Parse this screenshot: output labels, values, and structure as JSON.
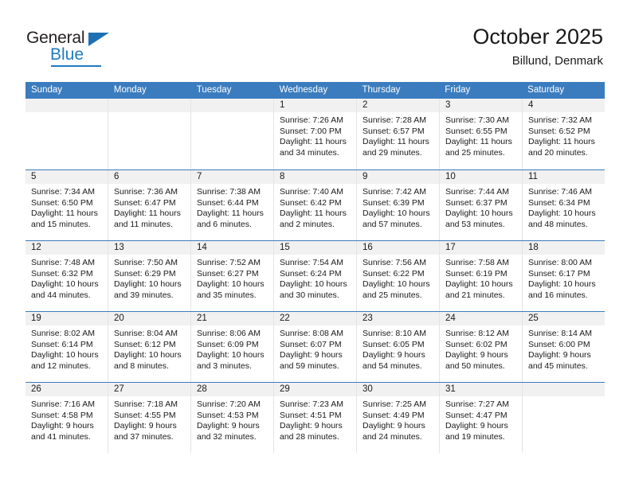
{
  "logo": {
    "general_text": "General",
    "blue_text": "Blue",
    "triangle_icon": "logo-triangle-icon"
  },
  "header": {
    "title": "October 2025",
    "subtitle": "Billund, Denmark"
  },
  "colors": {
    "header_blue": "#3a7cbe",
    "logo_blue": "#1f7ac4",
    "cell_head_gray": "#f1f1f1",
    "grid_line": "#e4e4e4"
  },
  "calendar": {
    "day_headers": [
      "Sunday",
      "Monday",
      "Tuesday",
      "Wednesday",
      "Thursday",
      "Friday",
      "Saturday"
    ],
    "weeks": [
      [
        {
          "day": "",
          "empty": true
        },
        {
          "day": "",
          "empty": true
        },
        {
          "day": "",
          "empty": true
        },
        {
          "day": "1",
          "sunrise": "Sunrise: 7:26 AM",
          "sunset": "Sunset: 7:00 PM",
          "daylight": "Daylight: 11 hours and 34 minutes."
        },
        {
          "day": "2",
          "sunrise": "Sunrise: 7:28 AM",
          "sunset": "Sunset: 6:57 PM",
          "daylight": "Daylight: 11 hours and 29 minutes."
        },
        {
          "day": "3",
          "sunrise": "Sunrise: 7:30 AM",
          "sunset": "Sunset: 6:55 PM",
          "daylight": "Daylight: 11 hours and 25 minutes."
        },
        {
          "day": "4",
          "sunrise": "Sunrise: 7:32 AM",
          "sunset": "Sunset: 6:52 PM",
          "daylight": "Daylight: 11 hours and 20 minutes."
        }
      ],
      [
        {
          "day": "5",
          "sunrise": "Sunrise: 7:34 AM",
          "sunset": "Sunset: 6:50 PM",
          "daylight": "Daylight: 11 hours and 15 minutes."
        },
        {
          "day": "6",
          "sunrise": "Sunrise: 7:36 AM",
          "sunset": "Sunset: 6:47 PM",
          "daylight": "Daylight: 11 hours and 11 minutes."
        },
        {
          "day": "7",
          "sunrise": "Sunrise: 7:38 AM",
          "sunset": "Sunset: 6:44 PM",
          "daylight": "Daylight: 11 hours and 6 minutes."
        },
        {
          "day": "8",
          "sunrise": "Sunrise: 7:40 AM",
          "sunset": "Sunset: 6:42 PM",
          "daylight": "Daylight: 11 hours and 2 minutes."
        },
        {
          "day": "9",
          "sunrise": "Sunrise: 7:42 AM",
          "sunset": "Sunset: 6:39 PM",
          "daylight": "Daylight: 10 hours and 57 minutes."
        },
        {
          "day": "10",
          "sunrise": "Sunrise: 7:44 AM",
          "sunset": "Sunset: 6:37 PM",
          "daylight": "Daylight: 10 hours and 53 minutes."
        },
        {
          "day": "11",
          "sunrise": "Sunrise: 7:46 AM",
          "sunset": "Sunset: 6:34 PM",
          "daylight": "Daylight: 10 hours and 48 minutes."
        }
      ],
      [
        {
          "day": "12",
          "sunrise": "Sunrise: 7:48 AM",
          "sunset": "Sunset: 6:32 PM",
          "daylight": "Daylight: 10 hours and 44 minutes."
        },
        {
          "day": "13",
          "sunrise": "Sunrise: 7:50 AM",
          "sunset": "Sunset: 6:29 PM",
          "daylight": "Daylight: 10 hours and 39 minutes."
        },
        {
          "day": "14",
          "sunrise": "Sunrise: 7:52 AM",
          "sunset": "Sunset: 6:27 PM",
          "daylight": "Daylight: 10 hours and 35 minutes."
        },
        {
          "day": "15",
          "sunrise": "Sunrise: 7:54 AM",
          "sunset": "Sunset: 6:24 PM",
          "daylight": "Daylight: 10 hours and 30 minutes."
        },
        {
          "day": "16",
          "sunrise": "Sunrise: 7:56 AM",
          "sunset": "Sunset: 6:22 PM",
          "daylight": "Daylight: 10 hours and 25 minutes."
        },
        {
          "day": "17",
          "sunrise": "Sunrise: 7:58 AM",
          "sunset": "Sunset: 6:19 PM",
          "daylight": "Daylight: 10 hours and 21 minutes."
        },
        {
          "day": "18",
          "sunrise": "Sunrise: 8:00 AM",
          "sunset": "Sunset: 6:17 PM",
          "daylight": "Daylight: 10 hours and 16 minutes."
        }
      ],
      [
        {
          "day": "19",
          "sunrise": "Sunrise: 8:02 AM",
          "sunset": "Sunset: 6:14 PM",
          "daylight": "Daylight: 10 hours and 12 minutes."
        },
        {
          "day": "20",
          "sunrise": "Sunrise: 8:04 AM",
          "sunset": "Sunset: 6:12 PM",
          "daylight": "Daylight: 10 hours and 8 minutes."
        },
        {
          "day": "21",
          "sunrise": "Sunrise: 8:06 AM",
          "sunset": "Sunset: 6:09 PM",
          "daylight": "Daylight: 10 hours and 3 minutes."
        },
        {
          "day": "22",
          "sunrise": "Sunrise: 8:08 AM",
          "sunset": "Sunset: 6:07 PM",
          "daylight": "Daylight: 9 hours and 59 minutes."
        },
        {
          "day": "23",
          "sunrise": "Sunrise: 8:10 AM",
          "sunset": "Sunset: 6:05 PM",
          "daylight": "Daylight: 9 hours and 54 minutes."
        },
        {
          "day": "24",
          "sunrise": "Sunrise: 8:12 AM",
          "sunset": "Sunset: 6:02 PM",
          "daylight": "Daylight: 9 hours and 50 minutes."
        },
        {
          "day": "25",
          "sunrise": "Sunrise: 8:14 AM",
          "sunset": "Sunset: 6:00 PM",
          "daylight": "Daylight: 9 hours and 45 minutes."
        }
      ],
      [
        {
          "day": "26",
          "sunrise": "Sunrise: 7:16 AM",
          "sunset": "Sunset: 4:58 PM",
          "daylight": "Daylight: 9 hours and 41 minutes."
        },
        {
          "day": "27",
          "sunrise": "Sunrise: 7:18 AM",
          "sunset": "Sunset: 4:55 PM",
          "daylight": "Daylight: 9 hours and 37 minutes."
        },
        {
          "day": "28",
          "sunrise": "Sunrise: 7:20 AM",
          "sunset": "Sunset: 4:53 PM",
          "daylight": "Daylight: 9 hours and 32 minutes."
        },
        {
          "day": "29",
          "sunrise": "Sunrise: 7:23 AM",
          "sunset": "Sunset: 4:51 PM",
          "daylight": "Daylight: 9 hours and 28 minutes."
        },
        {
          "day": "30",
          "sunrise": "Sunrise: 7:25 AM",
          "sunset": "Sunset: 4:49 PM",
          "daylight": "Daylight: 9 hours and 24 minutes."
        },
        {
          "day": "31",
          "sunrise": "Sunrise: 7:27 AM",
          "sunset": "Sunset: 4:47 PM",
          "daylight": "Daylight: 9 hours and 19 minutes."
        },
        {
          "day": "",
          "empty": true
        }
      ]
    ]
  }
}
